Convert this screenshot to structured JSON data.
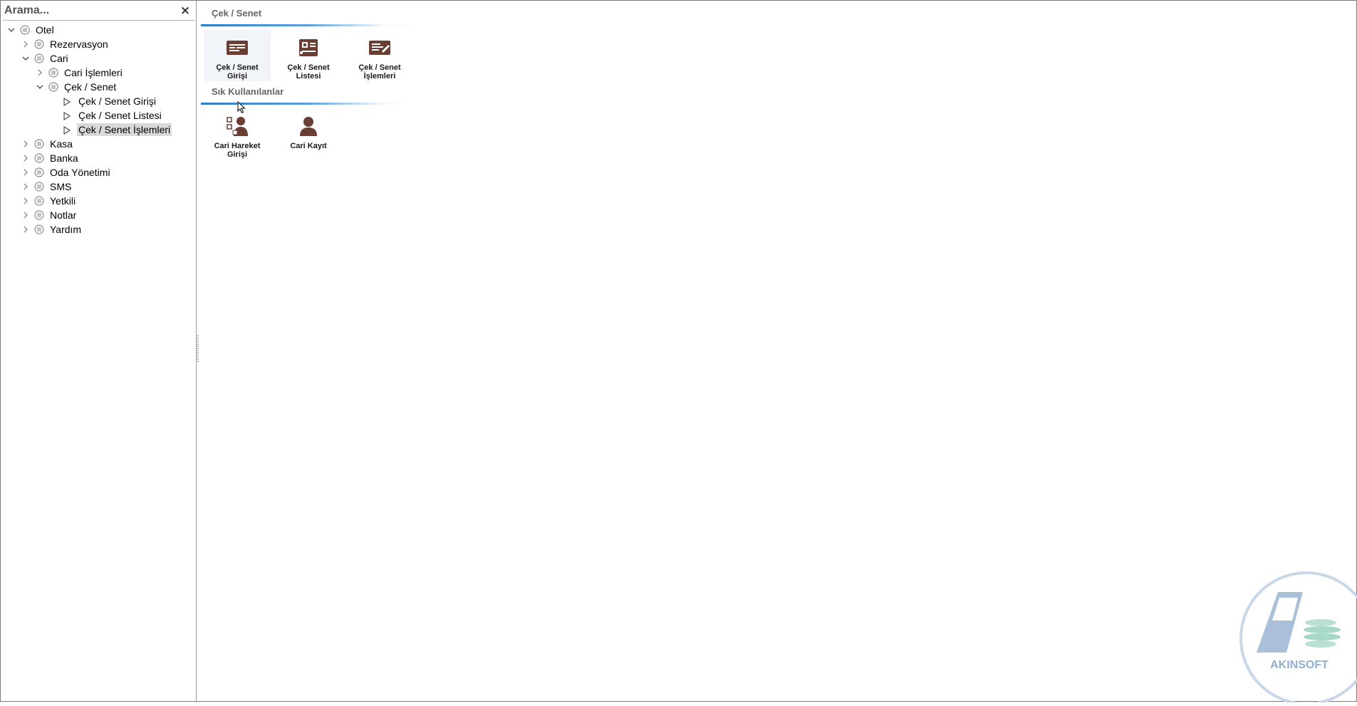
{
  "search": {
    "placeholder": "Arama...",
    "close_glyph": "×"
  },
  "tree": [
    {
      "label": "Otel",
      "expander": "expanded",
      "icon": "list-circle-icon"
    },
    {
      "label": "Rezervasyon",
      "expander": "collapsed",
      "icon": "list-circle-icon"
    },
    {
      "label": "Cari",
      "expander": "expanded",
      "icon": "list-circle-icon"
    },
    {
      "label": "Cari İşlemleri",
      "expander": "collapsed",
      "icon": "list-circle-icon"
    },
    {
      "label": "Çek / Senet",
      "expander": "expanded",
      "icon": "list-circle-icon"
    },
    {
      "label": "Çek / Senet Girişi",
      "icon": "triangle-outline-icon"
    },
    {
      "label": "Çek / Senet Listesi",
      "icon": "triangle-outline-icon"
    },
    {
      "label": "Çek / Senet İşlemleri",
      "icon": "triangle-outline-icon",
      "selected": true
    },
    {
      "label": "Kasa",
      "expander": "collapsed",
      "icon": "list-circle-icon"
    },
    {
      "label": "Banka",
      "expander": "collapsed",
      "icon": "list-circle-icon"
    },
    {
      "label": "Oda Yönetimi",
      "expander": "collapsed",
      "icon": "list-circle-icon"
    },
    {
      "label": "SMS",
      "expander": "collapsed",
      "icon": "list-circle-icon"
    },
    {
      "label": "Yetkili",
      "expander": "collapsed",
      "icon": "list-circle-icon"
    },
    {
      "label": "Notlar",
      "expander": "collapsed",
      "icon": "list-circle-icon"
    },
    {
      "label": "Yardım",
      "expander": "collapsed",
      "icon": "list-circle-icon"
    }
  ],
  "groups": [
    {
      "title": "Çek / Senet",
      "tiles": [
        {
          "label": "Çek / Senet\nGirişi",
          "icon": "cheque-entry-icon",
          "hover": true
        },
        {
          "label": "Çek / Senet\nListesi",
          "icon": "cheque-list-icon"
        },
        {
          "label": "Çek / Senet\nİşlemleri",
          "icon": "cheque-operations-icon"
        }
      ]
    },
    {
      "title": "Sık Kullanılanlar",
      "tiles": [
        {
          "label": "Cari Hareket\nGirişi",
          "icon": "account-movement-icon"
        },
        {
          "label": "Cari Kayıt",
          "icon": "account-record-icon"
        }
      ]
    }
  ],
  "logo": {
    "text": "AKINSOFT"
  },
  "colors": {
    "accent_line": "#2d7dc7",
    "icon_brown": "#6b3e33",
    "selection": "#d9d9d9",
    "logo_blue": "#7ea3c6",
    "logo_green": "#9fd3c0"
  }
}
